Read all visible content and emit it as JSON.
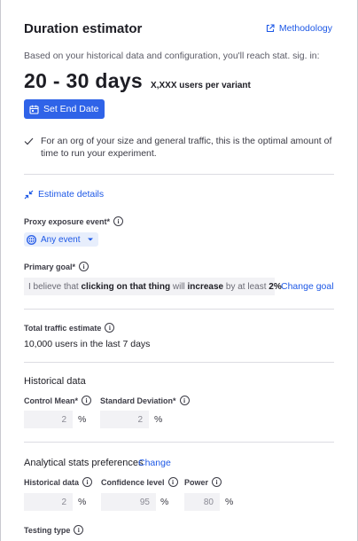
{
  "header": {
    "title": "Duration estimator",
    "methodology_label": "Methodology"
  },
  "estimate": {
    "intro": "Based on your historical data and configuration, you'll reach stat. sig. in:",
    "range": "20 - 30 days",
    "users_per_variant": "X,XXX users per variant",
    "set_end_date_label": "Set End Date",
    "note": "For an org of your size and general traffic, this is the optimal amount of time to run your experiment."
  },
  "details": {
    "link_label": "Estimate details",
    "proxy_label": "Proxy exposure event*",
    "proxy_value": "Any event",
    "goal_label": "Primary goal*",
    "goal_sentence": {
      "prefix": "I believe that",
      "action": "clicking on that thing",
      "will": "will",
      "direction": "increase",
      "by": "by at least",
      "amount": "2%"
    },
    "change_goal_label": "Change goal"
  },
  "traffic": {
    "label": "Total traffic estimate",
    "value": "10,000 users in the last 7 days"
  },
  "historical": {
    "title": "Historical data",
    "control_mean_label": "Control Mean*",
    "control_mean_value": "2",
    "std_dev_label": "Standard Deviation*",
    "std_dev_value": "2",
    "unit": "%"
  },
  "stats": {
    "title": "Analytical stats preferences",
    "change_label": "Change",
    "historical_label": "Historical data",
    "historical_value": "2",
    "confidence_label": "Confidence level",
    "confidence_value": "95",
    "power_label": "Power",
    "power_value": "80",
    "unit": "%",
    "testing_type_label": "Testing type"
  },
  "colors": {
    "accent": "#2f63e8",
    "link": "#1d58e6",
    "input_bg": "#f2f2f5",
    "divider": "#dcdce2"
  },
  "icons": {
    "methodology": "external-link-icon",
    "set_end_date": "calendar-icon",
    "note": "check-icon",
    "details": "collapse-arrows-icon",
    "proxy": "globe-icon",
    "dropdown": "chevron-down-icon",
    "info": "info-icon"
  }
}
